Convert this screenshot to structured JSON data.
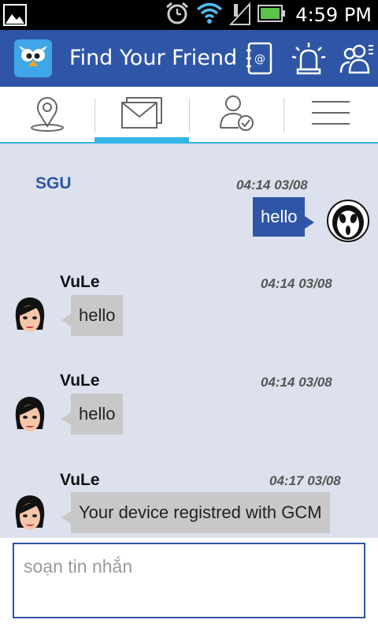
{
  "status_bar": {
    "time": "4:59 PM",
    "icons": [
      "gallery-icon",
      "alarm-icon",
      "wifi-icon",
      "signal-icon",
      "battery-icon"
    ]
  },
  "action_bar": {
    "title": "Find Your Friend",
    "icons": [
      "app-logo-icon",
      "contacts-book-icon",
      "siren-icon",
      "group-icon"
    ]
  },
  "tabs": [
    {
      "name": "map-pin-icon",
      "active": false
    },
    {
      "name": "envelope-icon",
      "active": true
    },
    {
      "name": "user-check-icon",
      "active": false
    },
    {
      "name": "menu-icon",
      "active": false
    }
  ],
  "messages": [
    {
      "sender": "SGU",
      "time": "04:14 03/08",
      "text": "hello",
      "direction": "out"
    },
    {
      "sender": "VuLe",
      "time": "04:14 03/08",
      "text": "hello",
      "direction": "in"
    },
    {
      "sender": "VuLe",
      "time": "04:14 03/08",
      "text": "hello",
      "direction": "in"
    },
    {
      "sender": "VuLe",
      "time": "04:17 03/08",
      "text": "Your device registred with GCM",
      "direction": "in"
    }
  ],
  "composer": {
    "placeholder": "soạn tin nhắn"
  },
  "colors": {
    "brand": "#2f56a6",
    "accent": "#33b5e5",
    "chat_bg": "#dce1ed",
    "incoming_bubble": "#c8c8c8"
  }
}
